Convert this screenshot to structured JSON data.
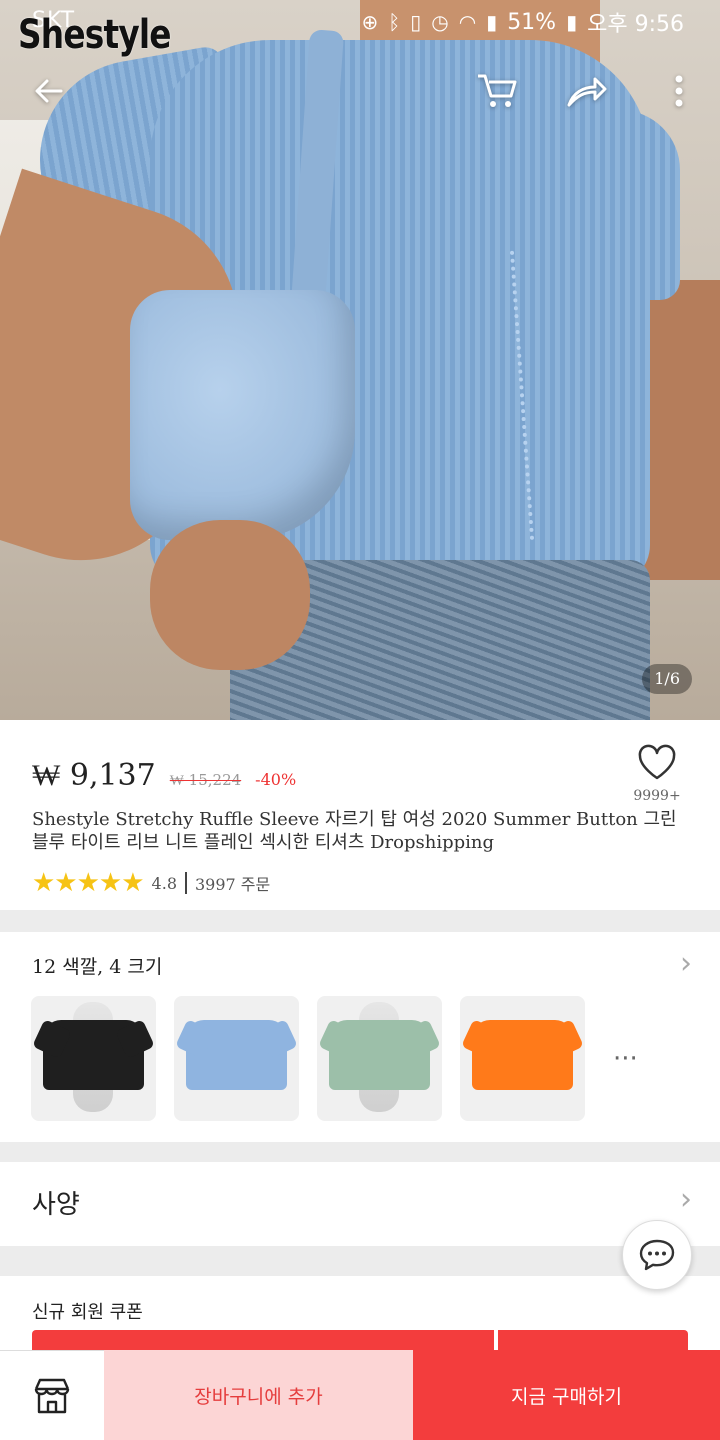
{
  "status_bar": {
    "carrier": "SKT",
    "battery": "51%",
    "time": "오후 9:56"
  },
  "brand": {
    "logo_text": "Shestyle"
  },
  "gallery": {
    "counter": "1/6"
  },
  "product": {
    "price": "₩ 9,137",
    "original_price": "₩ 15,224",
    "discount": "-40%",
    "wishlist_count": "9999+",
    "title": "Shestyle Stretchy Ruffle Sleeve 자르기 탑 여성 2020 Summer Button 그린 블루 타이트 리브 니트 플레인 섹시한 티셔츠 Dropshipping",
    "stars": "★★★★★",
    "rating": "4.8",
    "orders": "3997 주문"
  },
  "variants": {
    "summary": "12 색깔, 4 크기",
    "more": "···",
    "swatches": [
      "#1f1f1f",
      "#8fb4e0",
      "#9cbfa9",
      "#ff7a1a"
    ]
  },
  "spec": {
    "label": "사양"
  },
  "coupon": {
    "label": "신규 회원 쿠폰"
  },
  "actions": {
    "add_to_cart": "장바구니에 추가",
    "buy_now": "지금 구매하기"
  },
  "colors": {
    "accent": "#f33d3d",
    "accent_light": "#fcd5d5",
    "star": "#f6c315"
  }
}
